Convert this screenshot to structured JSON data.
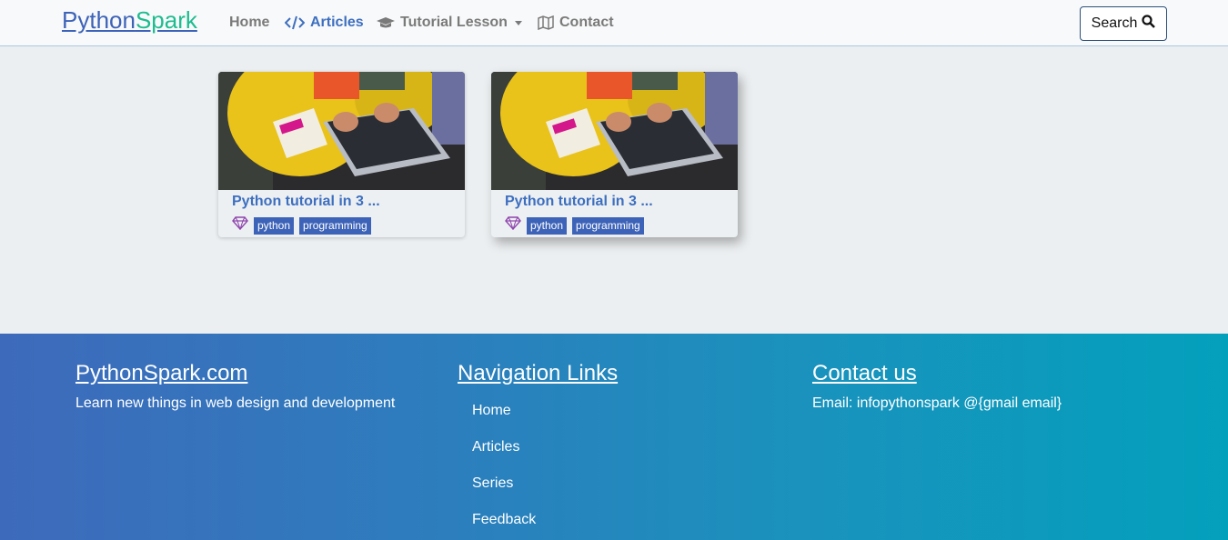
{
  "navbar": {
    "brand_part1": "Python",
    "brand_part2": "Spark",
    "items": [
      {
        "label": "Home",
        "icon": "none"
      },
      {
        "label": "Articles",
        "icon": "code-icon"
      },
      {
        "label": "Tutorial Lesson",
        "icon": "graduation-cap-icon"
      },
      {
        "label": "Contact",
        "icon": "map-icon"
      }
    ],
    "search_label": "Search"
  },
  "cards": [
    {
      "title": "Python tutorial in 3 ...",
      "tags": [
        "python",
        "programming"
      ]
    },
    {
      "title": "Python tutorial in 3 ...",
      "tags": [
        "python",
        "programming"
      ]
    }
  ],
  "footer": {
    "col1": {
      "heading": "PythonSpark.com",
      "text": "Learn new things in web design and development"
    },
    "col2": {
      "heading": "Navigation Links",
      "links": [
        "Home",
        "Articles",
        "Series",
        "Feedback"
      ]
    },
    "col3": {
      "heading": "Contact us",
      "text": "Email: infopythonspark @{gmail email}"
    }
  },
  "colors": {
    "accent": "#3d6fc0",
    "brand_green": "#1ebc8f",
    "tag_bg": "#3d63b8"
  }
}
